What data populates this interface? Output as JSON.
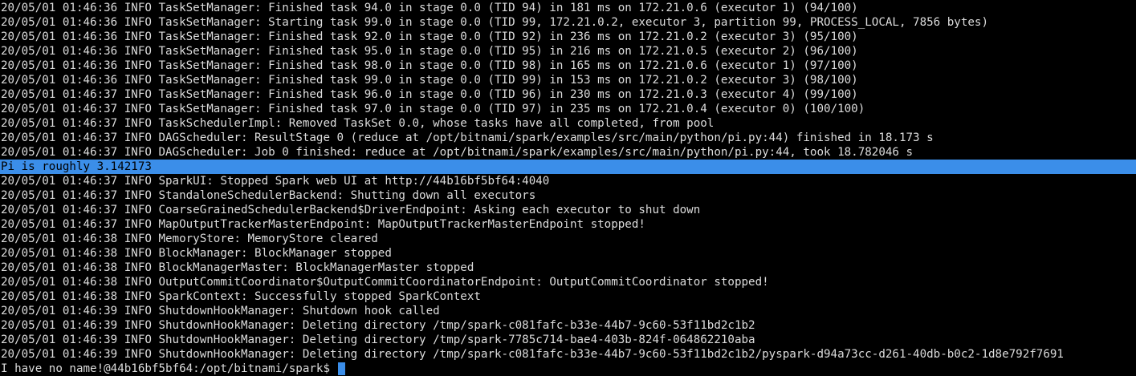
{
  "terminal": {
    "lines": [
      "20/05/01 01:46:36 INFO TaskSetManager: Finished task 94.0 in stage 0.0 (TID 94) in 181 ms on 172.21.0.6 (executor 1) (94/100)",
      "20/05/01 01:46:36 INFO TaskSetManager: Starting task 99.0 in stage 0.0 (TID 99, 172.21.0.2, executor 3, partition 99, PROCESS_LOCAL, 7856 bytes)",
      "20/05/01 01:46:36 INFO TaskSetManager: Finished task 92.0 in stage 0.0 (TID 92) in 236 ms on 172.21.0.2 (executor 3) (95/100)",
      "20/05/01 01:46:36 INFO TaskSetManager: Finished task 95.0 in stage 0.0 (TID 95) in 216 ms on 172.21.0.5 (executor 2) (96/100)",
      "20/05/01 01:46:36 INFO TaskSetManager: Finished task 98.0 in stage 0.0 (TID 98) in 165 ms on 172.21.0.6 (executor 1) (97/100)",
      "20/05/01 01:46:36 INFO TaskSetManager: Finished task 99.0 in stage 0.0 (TID 99) in 153 ms on 172.21.0.2 (executor 3) (98/100)",
      "20/05/01 01:46:37 INFO TaskSetManager: Finished task 96.0 in stage 0.0 (TID 96) in 230 ms on 172.21.0.3 (executor 4) (99/100)",
      "20/05/01 01:46:37 INFO TaskSetManager: Finished task 97.0 in stage 0.0 (TID 97) in 235 ms on 172.21.0.4 (executor 0) (100/100)",
      "20/05/01 01:46:37 INFO TaskSchedulerImpl: Removed TaskSet 0.0, whose tasks have all completed, from pool",
      "20/05/01 01:46:37 INFO DAGScheduler: ResultStage 0 (reduce at /opt/bitnami/spark/examples/src/main/python/pi.py:44) finished in 18.173 s",
      "20/05/01 01:46:37 INFO DAGScheduler: Job 0 finished: reduce at /opt/bitnami/spark/examples/src/main/python/pi.py:44, took 18.782046 s",
      "Pi is roughly 3.142173",
      "20/05/01 01:46:37 INFO SparkUI: Stopped Spark web UI at http://44b16bf5bf64:4040",
      "20/05/01 01:46:37 INFO StandaloneSchedulerBackend: Shutting down all executors",
      "20/05/01 01:46:37 INFO CoarseGrainedSchedulerBackend$DriverEndpoint: Asking each executor to shut down",
      "20/05/01 01:46:37 INFO MapOutputTrackerMasterEndpoint: MapOutputTrackerMasterEndpoint stopped!",
      "20/05/01 01:46:38 INFO MemoryStore: MemoryStore cleared",
      "20/05/01 01:46:38 INFO BlockManager: BlockManager stopped",
      "20/05/01 01:46:38 INFO BlockManagerMaster: BlockManagerMaster stopped",
      "20/05/01 01:46:38 INFO OutputCommitCoordinator$OutputCommitCoordinatorEndpoint: OutputCommitCoordinator stopped!",
      "20/05/01 01:46:38 INFO SparkContext: Successfully stopped SparkContext",
      "20/05/01 01:46:39 INFO ShutdownHookManager: Shutdown hook called",
      "20/05/01 01:46:39 INFO ShutdownHookManager: Deleting directory /tmp/spark-c081fafc-b33e-44b7-9c60-53f11bd2c1b2",
      "20/05/01 01:46:39 INFO ShutdownHookManager: Deleting directory /tmp/spark-7785c714-bae4-403b-824f-064862210aba",
      "20/05/01 01:46:39 INFO ShutdownHookManager: Deleting directory /tmp/spark-c081fafc-b33e-44b7-9c60-53f11bd2c1b2/pyspark-d94a73cc-d261-40db-b0c2-1d8e792f7691"
    ],
    "prompt": "I have no name!@44b16bf5bf64:/opt/bitnami/spark$ ",
    "colors": {
      "background": "#000000",
      "foreground": "#dcdcdc",
      "selection": "#3b8ee9",
      "cursor": "#3b8ee9"
    }
  }
}
